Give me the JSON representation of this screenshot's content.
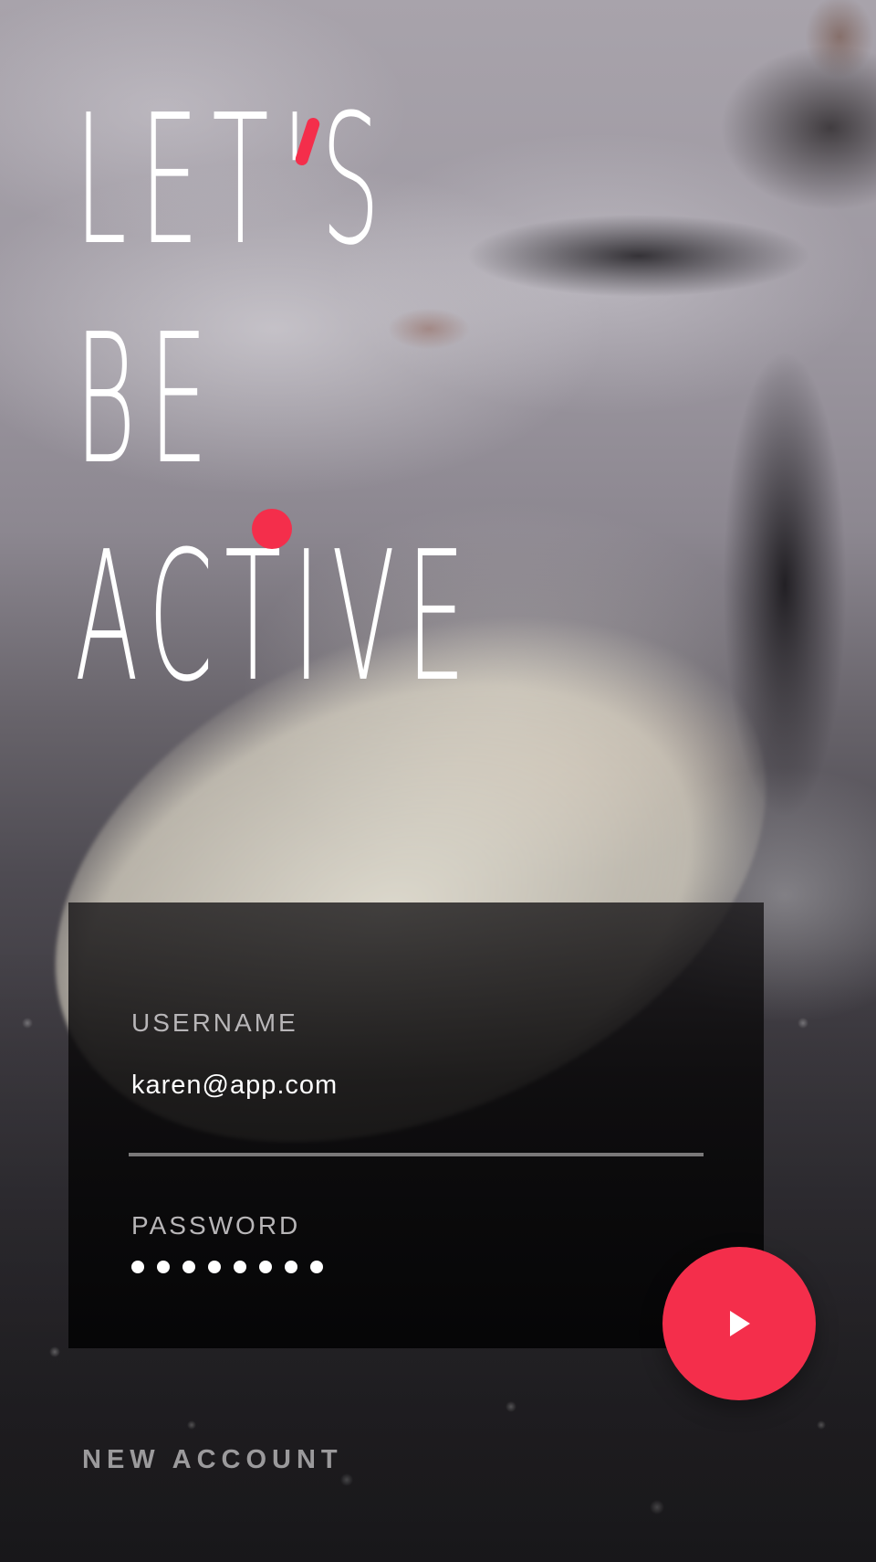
{
  "headline": {
    "line1": "Let's",
    "line2": "Be",
    "line3": "Active"
  },
  "login_form": {
    "username": {
      "label": "USERNAME",
      "value": "karen@app.com"
    },
    "password": {
      "label": "PASSWORD",
      "masked_length": 8
    },
    "submit_icon": "play-icon"
  },
  "footer": {
    "new_account_label": "NEW ACCOUNT"
  },
  "colors": {
    "accent": "#f42e4b",
    "text_primary": "#ffffff",
    "text_muted": "#b8b6b8",
    "card_background": "#0b0a0b"
  },
  "background_image": "surfer-photo"
}
